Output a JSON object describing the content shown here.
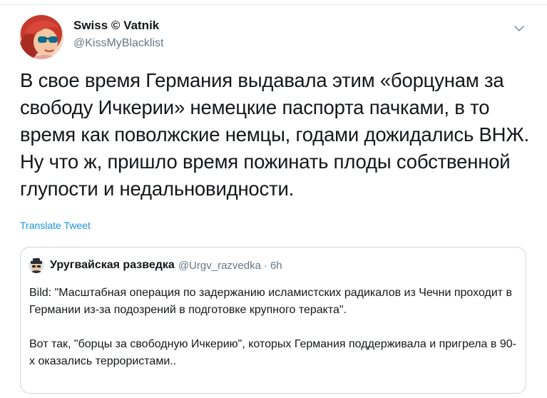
{
  "tweet": {
    "author": {
      "display_name": "Swiss © Vatnik",
      "handle": "@KissMyBlacklist",
      "avatar_icon": "cartoon-woman-red-hair-sunglasses-avatar"
    },
    "menu_icon": "chevron-down-icon",
    "text": "В свое время Германия выдавала этим «борцунам за свободу Ичкерии» немецкие паспорта пачками, в то время как поволжские немцы, годами дожидались ВНЖ. Ну что ж, пришло время пожинать плоды собственной глупости и недальновидности.",
    "translate_label": "Translate Tweet"
  },
  "quoted_tweet": {
    "author_name": "Уругвайская разведка",
    "handle": "@Urgv_razvedka",
    "separator": "·",
    "time": "6h",
    "avatar_icon": "spy-avatar",
    "paragraph_1": "Bild: \"Масштабная операция по задержанию исламистских радикалов из Чечни проходит в Германии из-за подозрений в подготовке крупного теракта\".",
    "paragraph_2": "Вот так, \"борцы за свободную Ичкерию\", которых Германия поддерживала и пригрела в 90-х оказались террористами.."
  },
  "colors": {
    "text": "#14171a",
    "secondary": "#657786",
    "link": "#1b95e0",
    "border": "#ccd6dd"
  }
}
